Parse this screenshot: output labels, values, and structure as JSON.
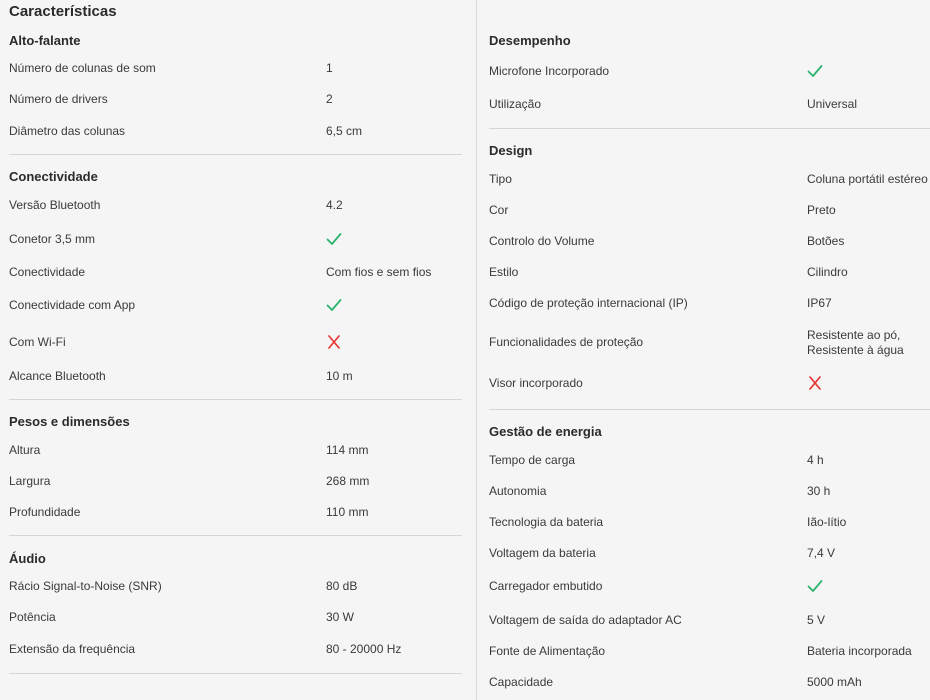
{
  "page_title": "Características",
  "colors": {
    "check": "#2db36b",
    "cross": "#e53935"
  },
  "left": [
    {
      "title": "Alto-falante",
      "rows": [
        {
          "label": "Número de colunas de som",
          "value": "1"
        },
        {
          "label": "Número de drivers",
          "value": "2"
        },
        {
          "label": "Diâmetro das colunas",
          "value": "6,5 cm"
        }
      ]
    },
    {
      "title": "Conectividade",
      "rows": [
        {
          "label": "Versão Bluetooth",
          "value": "4.2"
        },
        {
          "label": "Conetor 3,5 mm",
          "icon": "check-icon"
        },
        {
          "label": "Conectividade",
          "value": "Com fios e sem fios"
        },
        {
          "label": "Conectividade com App",
          "icon": "check-icon"
        },
        {
          "label": "Com Wi-Fi",
          "icon": "cross-icon"
        },
        {
          "label": "Alcance Bluetooth",
          "value": "10 m"
        }
      ]
    },
    {
      "title": "Pesos e dimensões",
      "rows": [
        {
          "label": "Altura",
          "value": "114 mm"
        },
        {
          "label": "Largura",
          "value": "268 mm"
        },
        {
          "label": "Profundidade",
          "value": "110 mm"
        }
      ]
    },
    {
      "title": "Áudio",
      "rows": [
        {
          "label": "Rácio Signal-to-Noise (SNR)",
          "value": "80 dB"
        },
        {
          "label": "Potência",
          "value": "30 W"
        },
        {
          "label": "Extensão da frequência",
          "value": "80 - 20000 Hz"
        }
      ]
    }
  ],
  "right": [
    {
      "title": "Desempenho",
      "rows": [
        {
          "label": "Microfone Incorporado",
          "icon": "check-icon"
        },
        {
          "label": "Utilização",
          "value": "Universal"
        }
      ]
    },
    {
      "title": "Design",
      "rows": [
        {
          "label": "Tipo",
          "value": "Coluna portátil estéreo"
        },
        {
          "label": "Cor",
          "value": "Preto"
        },
        {
          "label": "Controlo do Volume",
          "value": "Botões"
        },
        {
          "label": "Estilo",
          "value": "Cilindro"
        },
        {
          "label": "Código de proteção internacional (IP)",
          "value": "IP67"
        },
        {
          "label": "Funcionalidades de proteção",
          "value_lines": [
            "Resistente ao pó,",
            "Resistente à água"
          ]
        },
        {
          "label": "Visor incorporado",
          "icon": "cross-icon"
        }
      ]
    },
    {
      "title": "Gestão de energia",
      "rows": [
        {
          "label": "Tempo de carga",
          "value": "4 h"
        },
        {
          "label": "Autonomia",
          "value": "30 h"
        },
        {
          "label": "Tecnologia da bateria",
          "value": "Ião-lítio"
        },
        {
          "label": "Voltagem da bateria",
          "value": "7,4 V"
        },
        {
          "label": "Carregador embutido",
          "icon": "check-icon"
        },
        {
          "label": "Voltagem de saída do adaptador AC",
          "value": "5 V"
        },
        {
          "label": "Fonte de Alimentação",
          "value": "Bateria incorporada"
        },
        {
          "label": "Capacidade",
          "value": "5000 mAh"
        }
      ]
    }
  ]
}
